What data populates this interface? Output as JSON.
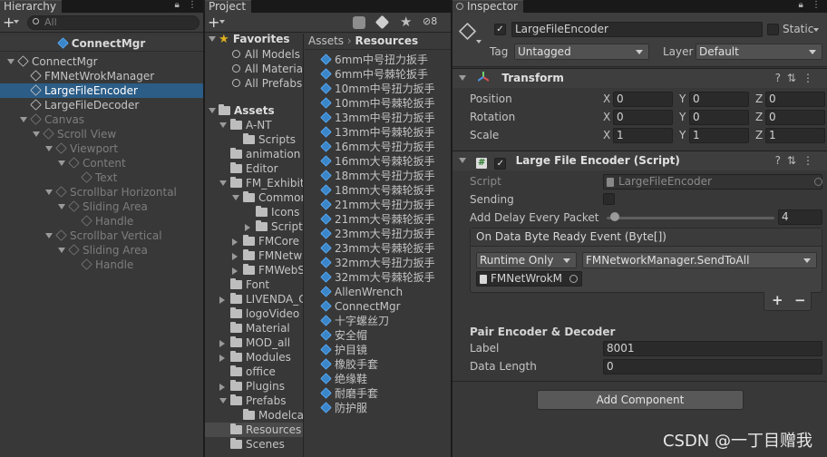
{
  "hierarchy": {
    "tab": "Hierarchy",
    "add": "+",
    "search_placeholder": "All",
    "scene": "ConnectMgr",
    "items": [
      {
        "label": "ConnectMgr",
        "depth": 0,
        "state": "normal",
        "arrow": "down"
      },
      {
        "label": "FMNetWrokManager",
        "depth": 1,
        "state": "normal",
        "arrow": ""
      },
      {
        "label": "LargeFileEncoder",
        "depth": 1,
        "state": "selected",
        "arrow": ""
      },
      {
        "label": "LargeFileDecoder",
        "depth": 1,
        "state": "normal",
        "arrow": ""
      },
      {
        "label": "Canvas",
        "depth": 1,
        "state": "dim",
        "arrow": "down"
      },
      {
        "label": "Scroll View",
        "depth": 2,
        "state": "dim",
        "arrow": "down"
      },
      {
        "label": "Viewport",
        "depth": 3,
        "state": "dim",
        "arrow": "down"
      },
      {
        "label": "Content",
        "depth": 4,
        "state": "dim",
        "arrow": "down"
      },
      {
        "label": "Text",
        "depth": 5,
        "state": "dim",
        "arrow": ""
      },
      {
        "label": "Scrollbar Horizontal",
        "depth": 3,
        "state": "dim",
        "arrow": "down"
      },
      {
        "label": "Sliding Area",
        "depth": 4,
        "state": "dim",
        "arrow": "down"
      },
      {
        "label": "Handle",
        "depth": 5,
        "state": "dim",
        "arrow": ""
      },
      {
        "label": "Scrollbar Vertical",
        "depth": 3,
        "state": "dim",
        "arrow": "down"
      },
      {
        "label": "Sliding Area",
        "depth": 4,
        "state": "dim",
        "arrow": "down"
      },
      {
        "label": "Handle",
        "depth": 5,
        "state": "dim",
        "arrow": ""
      }
    ]
  },
  "project": {
    "tab": "Project",
    "add": "+",
    "count": "8",
    "favorites_label": "Favorites",
    "favorites": [
      "All Models",
      "All Materia",
      "All Prefabs"
    ],
    "assets_label": "Assets",
    "tree": [
      {
        "label": "A-NT",
        "depth": 1,
        "arrow": "down"
      },
      {
        "label": "Scripts",
        "depth": 2,
        "arrow": ""
      },
      {
        "label": "animation",
        "depth": 1,
        "arrow": ""
      },
      {
        "label": "Editor",
        "depth": 1,
        "arrow": ""
      },
      {
        "label": "FM_Exhibit",
        "depth": 1,
        "arrow": "down"
      },
      {
        "label": "Commor",
        "depth": 2,
        "arrow": "down"
      },
      {
        "label": "Icons",
        "depth": 3,
        "arrow": ""
      },
      {
        "label": "Script",
        "depth": 3,
        "arrow": "right"
      },
      {
        "label": "FMCore",
        "depth": 2,
        "arrow": "right"
      },
      {
        "label": "FMNetw",
        "depth": 2,
        "arrow": "right"
      },
      {
        "label": "FMWebS",
        "depth": 2,
        "arrow": "right"
      },
      {
        "label": "Font",
        "depth": 1,
        "arrow": ""
      },
      {
        "label": "LIVENDA_C",
        "depth": 1,
        "arrow": "right"
      },
      {
        "label": "logoVideo",
        "depth": 1,
        "arrow": ""
      },
      {
        "label": "Material",
        "depth": 1,
        "arrow": ""
      },
      {
        "label": "MOD_all",
        "depth": 1,
        "arrow": "right"
      },
      {
        "label": "Modules",
        "depth": 1,
        "arrow": "right"
      },
      {
        "label": "office",
        "depth": 1,
        "arrow": ""
      },
      {
        "label": "Plugins",
        "depth": 1,
        "arrow": "right"
      },
      {
        "label": "Prefabs",
        "depth": 1,
        "arrow": "down"
      },
      {
        "label": "Modelca",
        "depth": 2,
        "arrow": ""
      },
      {
        "label": "Resources",
        "depth": 1,
        "arrow": "",
        "selected": true
      },
      {
        "label": "Scenes",
        "depth": 1,
        "arrow": ""
      }
    ],
    "breadcrumb": [
      "Assets",
      "Resources"
    ],
    "resources": [
      "6mm中号扭力扳手",
      "6mm中号棘轮扳手",
      "10mm中号扭力扳手",
      "10mm中号棘轮扳手",
      "13mm中号扭力扳手",
      "13mm中号棘轮扳手",
      "16mm大号扭力扳手",
      "16mm大号棘轮扳手",
      "18mm大号扭力扳手",
      "18mm大号棘轮扳手",
      "21mm大号扭力扳手",
      "21mm大号棘轮扳手",
      "23mm大号扭力扳手",
      "23mm大号棘轮扳手",
      "32mm大号扭力扳手",
      "32mm大号棘轮扳手",
      "AllenWrench",
      "ConnectMgr",
      "十字螺丝刀",
      "安全帽",
      "护目镜",
      "橡胶手套",
      "绝缘鞋",
      "耐磨手套",
      "防护服"
    ]
  },
  "inspector": {
    "tab": "Inspector",
    "object_name": "LargeFileEncoder",
    "static_label": "Static",
    "tag_label": "Tag",
    "tag_value": "Untagged",
    "layer_label": "Layer",
    "layer_value": "Default",
    "transform": {
      "title": "Transform",
      "rows": [
        {
          "label": "Position",
          "x": "0",
          "y": "0",
          "z": "0"
        },
        {
          "label": "Rotation",
          "x": "0",
          "y": "0",
          "z": "0"
        },
        {
          "label": "Scale",
          "x": "1",
          "y": "1",
          "z": "1"
        }
      ],
      "axis": [
        "X",
        "Y",
        "Z"
      ]
    },
    "script_component": {
      "title": "Large File Encoder (Script)",
      "script_label": "Script",
      "script_value": "LargeFileEncoder",
      "sending_label": "Sending",
      "delay_label": "Add Delay Every Packet",
      "delay_value": "4",
      "delay_fraction": 0.02,
      "event_title": "On Data Byte Ready Event (Byte[])",
      "runtime": "Runtime Only",
      "function": "FMNetworkManager.SendToAll",
      "target": "FMNetWrokM",
      "plus": "+",
      "minus": "−",
      "pair_title": "Pair Encoder & Decoder",
      "label_label": "Label",
      "label_value": "8001",
      "length_label": "Data Length",
      "length_value": "0"
    },
    "add_component": "Add Component"
  },
  "watermark": "CSDN @一丁目赠我"
}
